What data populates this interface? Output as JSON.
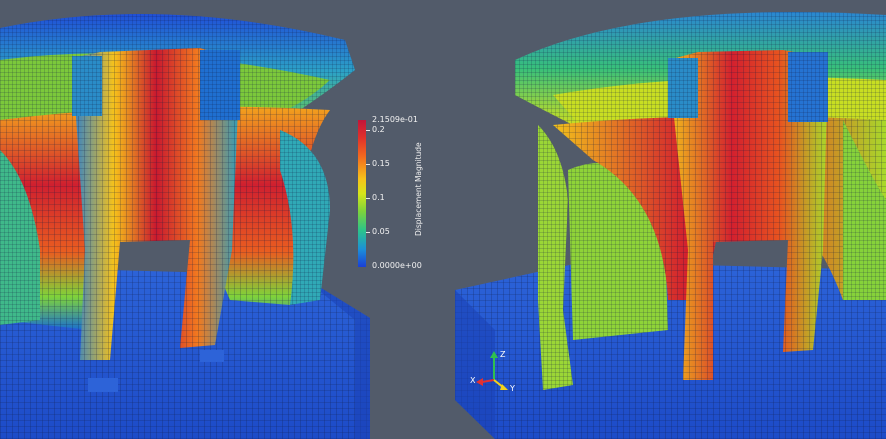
{
  "colorbar": {
    "title": "Displacement Magnitude",
    "max_label": "2.1509e-01",
    "min_label": "0.0000e+00",
    "ticks": [
      "0.2",
      "0.15",
      "0.1",
      "0.05"
    ]
  },
  "axes": {
    "x": "X",
    "y": "Y",
    "z": "Z"
  },
  "colors": {
    "background": "#525b6a",
    "high": "#c2153a",
    "mid": "#d6e51b",
    "low": "#1a3fd6"
  }
}
